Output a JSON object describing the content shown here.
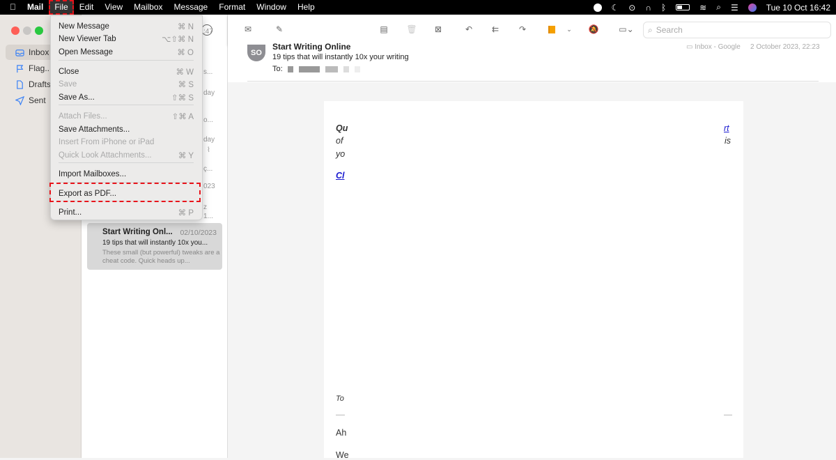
{
  "menubar": {
    "app": "Mail",
    "items": [
      "File",
      "Edit",
      "View",
      "Mailbox",
      "Message",
      "Format",
      "Window",
      "Help"
    ],
    "clock": "Tue 10 Oct  16:42"
  },
  "sidebar": {
    "items": [
      {
        "label": "Inbox",
        "icon": "inbox-icon"
      },
      {
        "label": "Flag...",
        "icon": "flag-icon"
      },
      {
        "label": "Drafts",
        "icon": "document-icon"
      },
      {
        "label": "Sent",
        "icon": "paper-plane-icon"
      }
    ]
  },
  "file_menu": {
    "items": [
      {
        "label": "New Message",
        "shortcut": "⌘ N",
        "enabled": true
      },
      {
        "label": "New Viewer Tab",
        "shortcut": "⌥⇧⌘ N",
        "enabled": true
      },
      {
        "label": "Open Message",
        "shortcut": "⌘ O",
        "enabled": true
      },
      {
        "label": "Close",
        "shortcut": "⌘ W",
        "enabled": true
      },
      {
        "label": "Save",
        "shortcut": "⌘ S",
        "enabled": false
      },
      {
        "label": "Save As...",
        "shortcut": "⇧⌘ S",
        "enabled": true
      },
      {
        "label": "Attach Files...",
        "shortcut": "⇧⌘ A",
        "enabled": false
      },
      {
        "label": "Save Attachments...",
        "shortcut": "",
        "enabled": true
      },
      {
        "label": "Insert From iPhone or iPad",
        "shortcut": "",
        "enabled": false
      },
      {
        "label": "Quick Look Attachments...",
        "shortcut": "⌘ Y",
        "enabled": false
      },
      {
        "label": "Import Mailboxes...",
        "shortcut": "",
        "enabled": true
      },
      {
        "label": "Export as PDF...",
        "shortcut": "",
        "enabled": true
      },
      {
        "label": "Print...",
        "shortcut": "⌘ P",
        "enabled": true
      }
    ]
  },
  "message_list": {
    "fragments": [
      ":47",
      "s...",
      "day",
      "o...",
      "day",
      "ç...",
      "023",
      "z",
      "1..."
    ],
    "selected": {
      "sender": "Start Writing Onl...",
      "date": "02/10/2023",
      "subject": "19 tips that will instantly 10x you...",
      "preview": "These small (but powerful) tweaks are a cheat code. Quick heads up..."
    }
  },
  "toolbar": {
    "search_placeholder": "Search",
    "flag_color": "#f5a000"
  },
  "message": {
    "avatar": "SO",
    "sender": "Start Writing Online",
    "subject": "19 tips that will instantly 10x your writing",
    "to_label": "To:",
    "mailbox": "Inbox - Google",
    "date": "2 October 2023, 22:23"
  },
  "body": {
    "frag1": "Qu",
    "frag1r": "rt",
    "frag2": "of",
    "frag2r": "is",
    "frag3": "yo",
    "link": "Cl",
    "frag4": "To",
    "frag5": "Ah",
    "frag6": "We"
  }
}
